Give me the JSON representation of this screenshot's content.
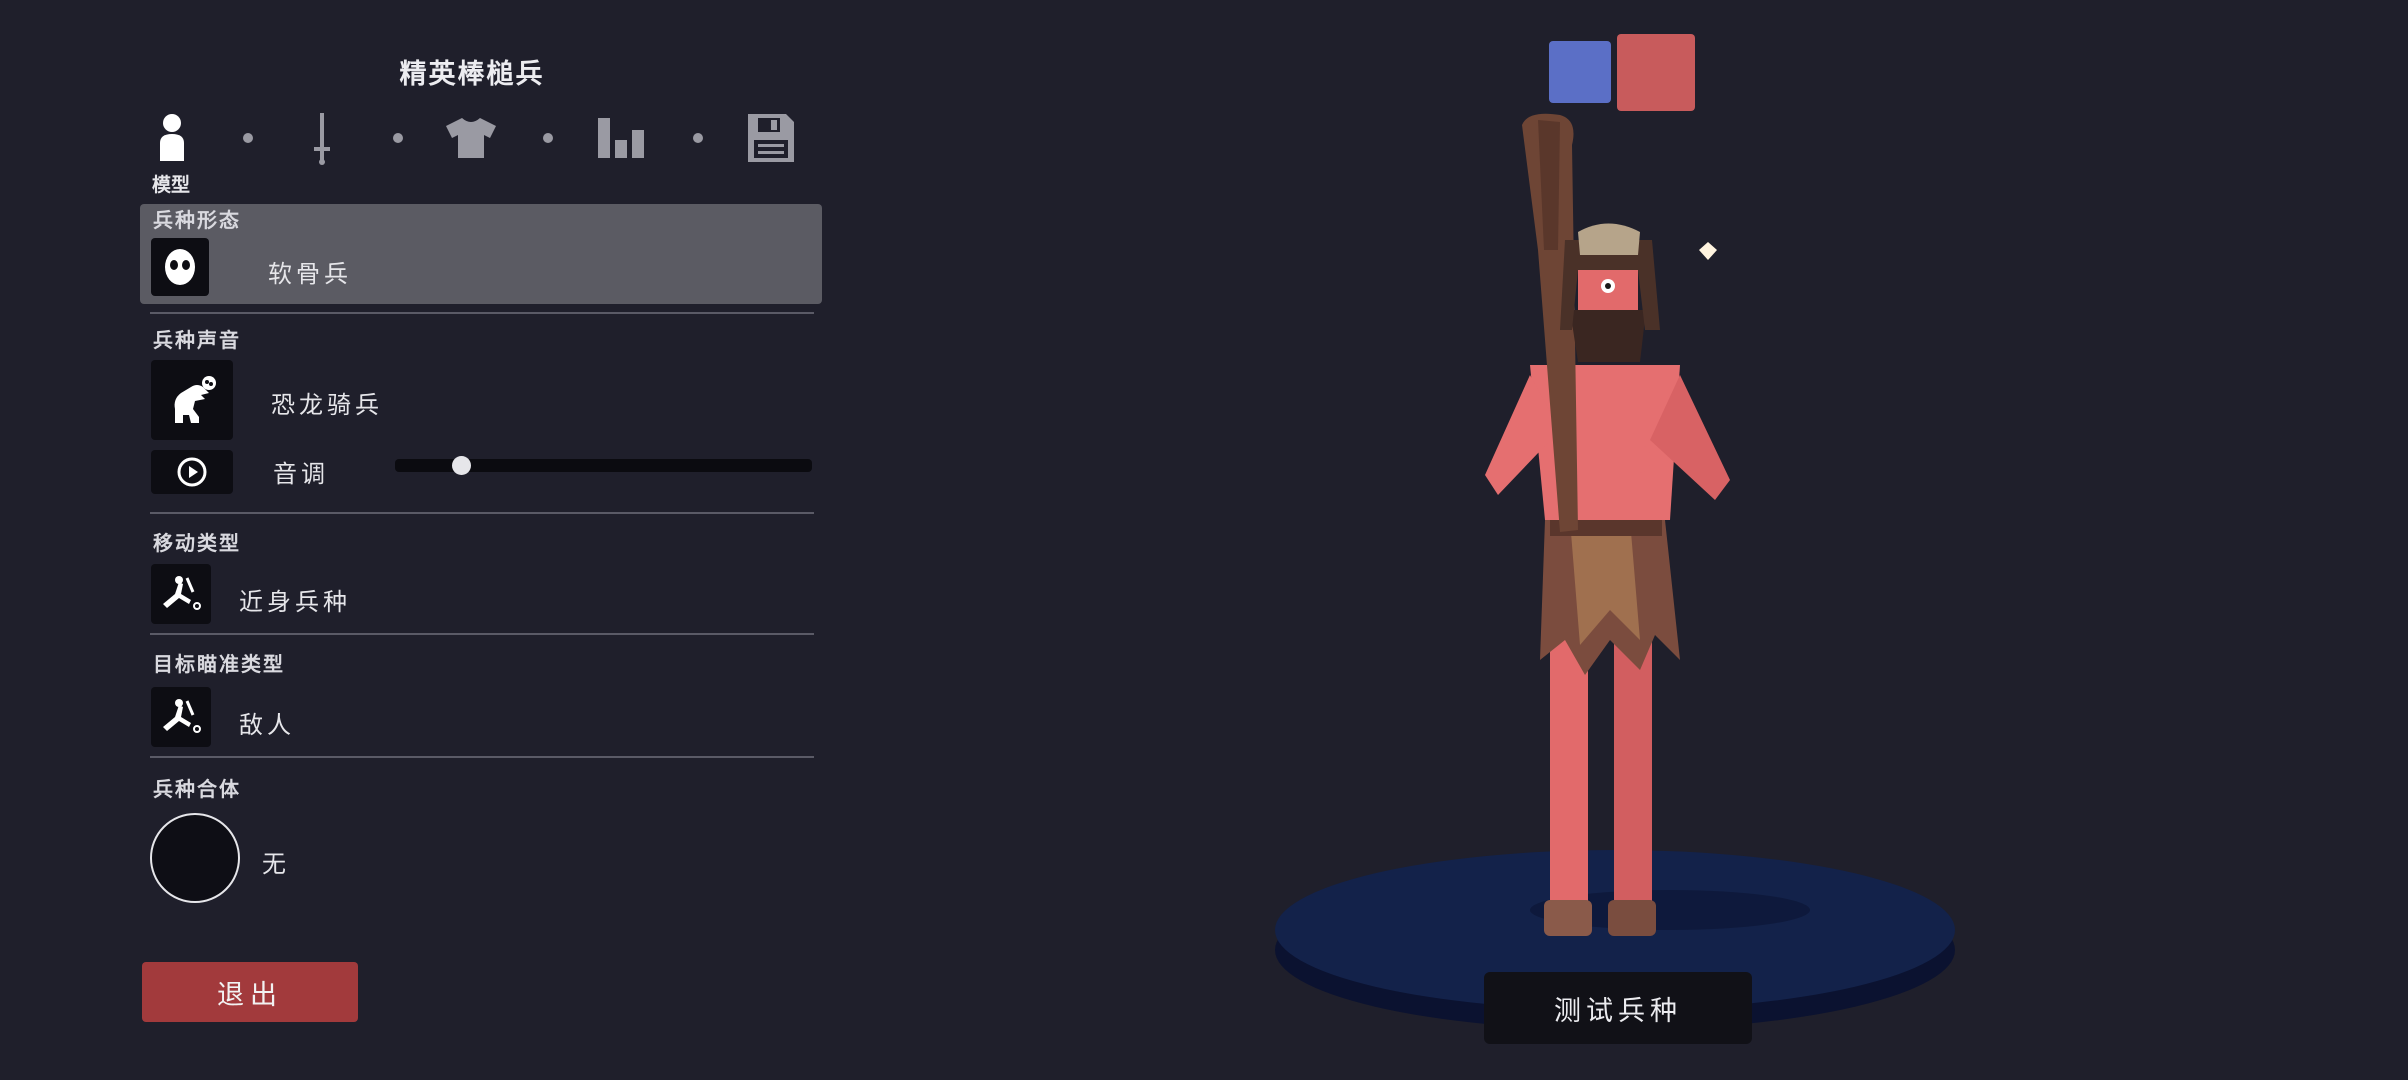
{
  "header": {
    "title": "精英棒槌兵"
  },
  "steps": {
    "active_label": "模型",
    "items": [
      {
        "icon": "person-icon",
        "active": true
      },
      {
        "icon": "sword-icon",
        "active": false
      },
      {
        "icon": "shirt-icon",
        "active": false
      },
      {
        "icon": "bar-chart-icon",
        "active": false
      },
      {
        "icon": "save-icon",
        "active": false
      }
    ]
  },
  "sections": {
    "form": {
      "heading": "兵种形态",
      "value": "软骨兵",
      "icon": "ghost-mask-icon"
    },
    "voice": {
      "heading": "兵种声音",
      "value": "恐龙骑兵",
      "icon": "dinosaur-icon",
      "pitch_label": "音调",
      "pitch_level": 0.16
    },
    "movement": {
      "heading": "移动类型",
      "value": "近身兵种",
      "icon": "melee-unit-icon"
    },
    "targeting": {
      "heading": "目标瞄准类型",
      "value": "敌人",
      "icon": "target-unit-icon"
    },
    "combine": {
      "heading": "兵种合体",
      "value": "无"
    }
  },
  "buttons": {
    "exit": "退出",
    "test_unit": "测试兵种"
  },
  "colors": {
    "team_blue": "#5b6fc6",
    "team_red": "#c85b5c",
    "exit_button": "#a23a3c",
    "background": "#1f1f2b"
  }
}
